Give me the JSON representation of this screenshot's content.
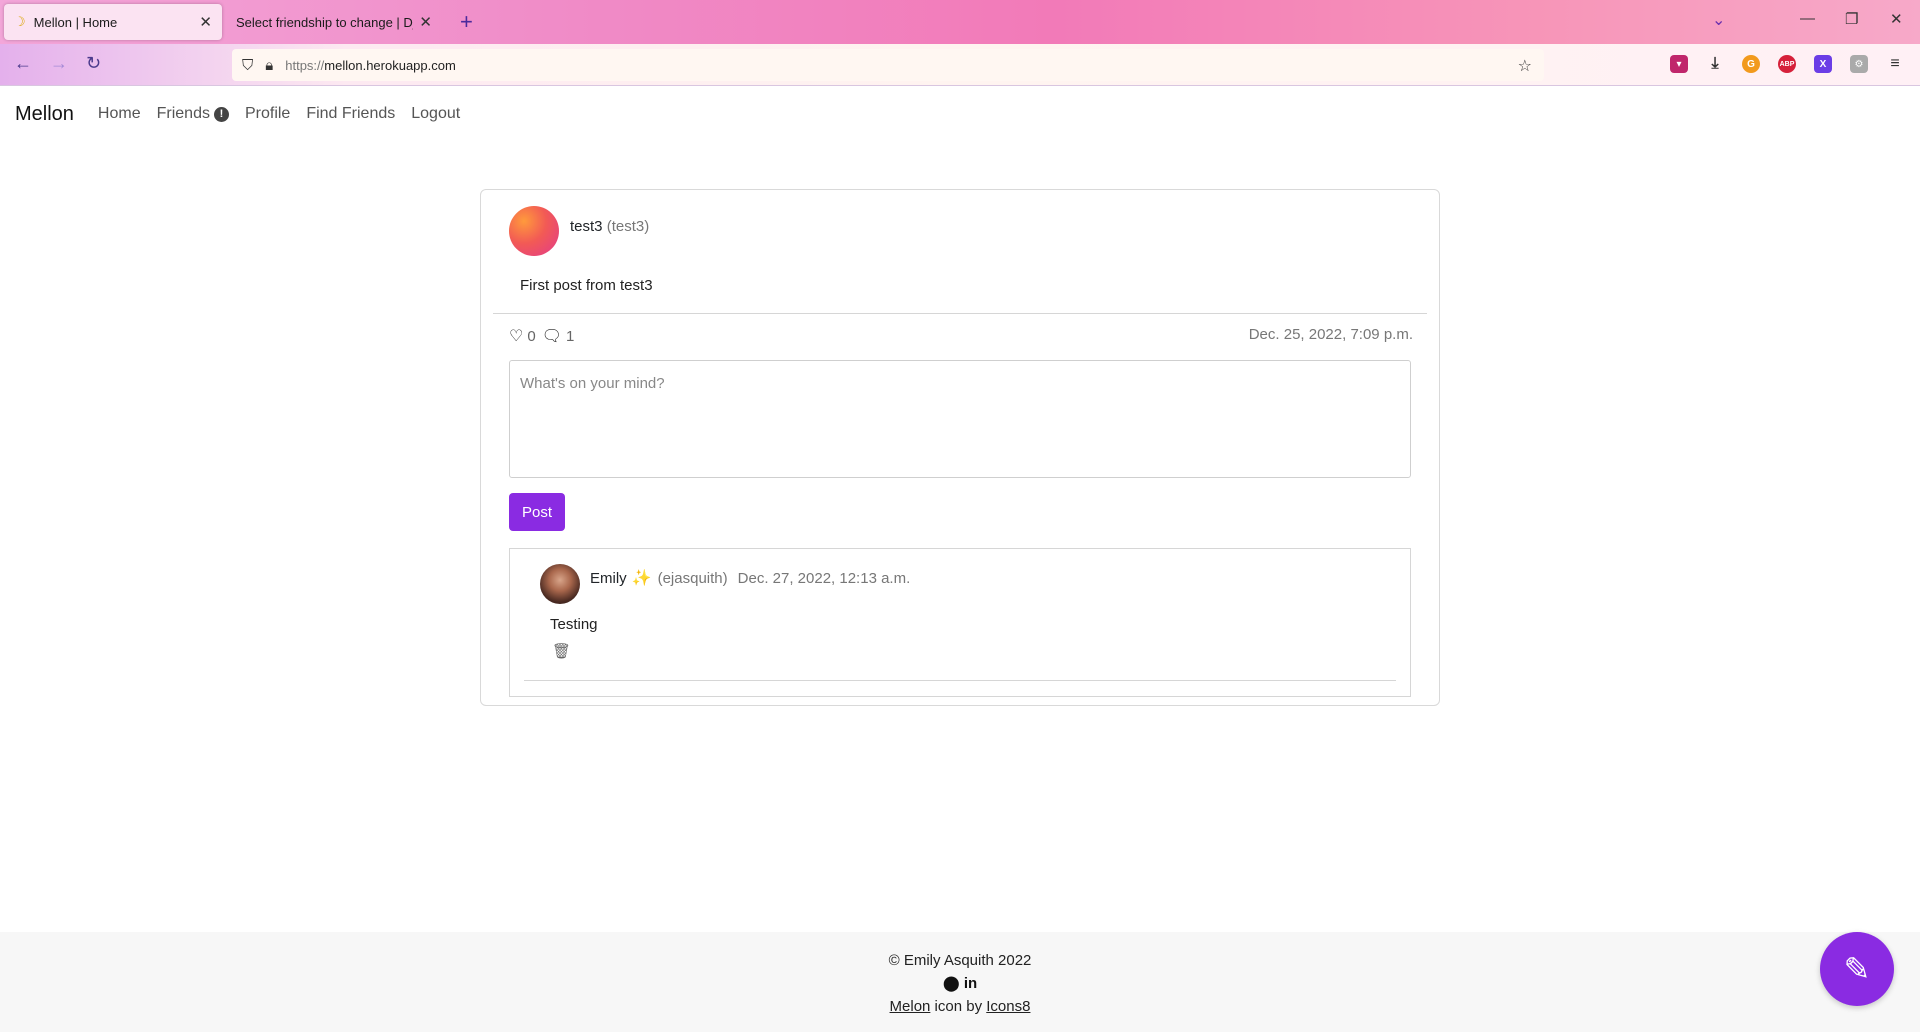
{
  "browser": {
    "tabs": [
      {
        "title": "Mellon | Home",
        "active": true
      },
      {
        "title": "Select friendship to change | Django"
      }
    ],
    "url_scheme": "https://",
    "url_host": "mellon.herokuapp.com"
  },
  "site": {
    "brand": "Mellon",
    "nav": {
      "home": "Home",
      "friends": "Friends",
      "friends_badge": "!",
      "profile": "Profile",
      "find_friends": "Find Friends",
      "logout": "Logout"
    }
  },
  "post": {
    "author_name": "test3",
    "author_handle": "(test3)",
    "body": "First post from test3",
    "likes": "0",
    "comments_count": "1",
    "date": "Dec. 25, 2022, 7:09 p.m.",
    "comment_placeholder": "What's on your mind?",
    "post_button": "Post"
  },
  "comments": [
    {
      "name": "Emily",
      "badge": "✨",
      "handle": "(ejasquith)",
      "date": "Dec. 27, 2022, 12:13 a.m.",
      "text": "Testing"
    }
  ],
  "footer": {
    "copyright": "© Emily Asquith 2022",
    "credit_link1": "Melon",
    "credit_mid": " icon by ",
    "credit_link2": "Icons8"
  },
  "colors": {
    "accent": "#8a2be2"
  }
}
